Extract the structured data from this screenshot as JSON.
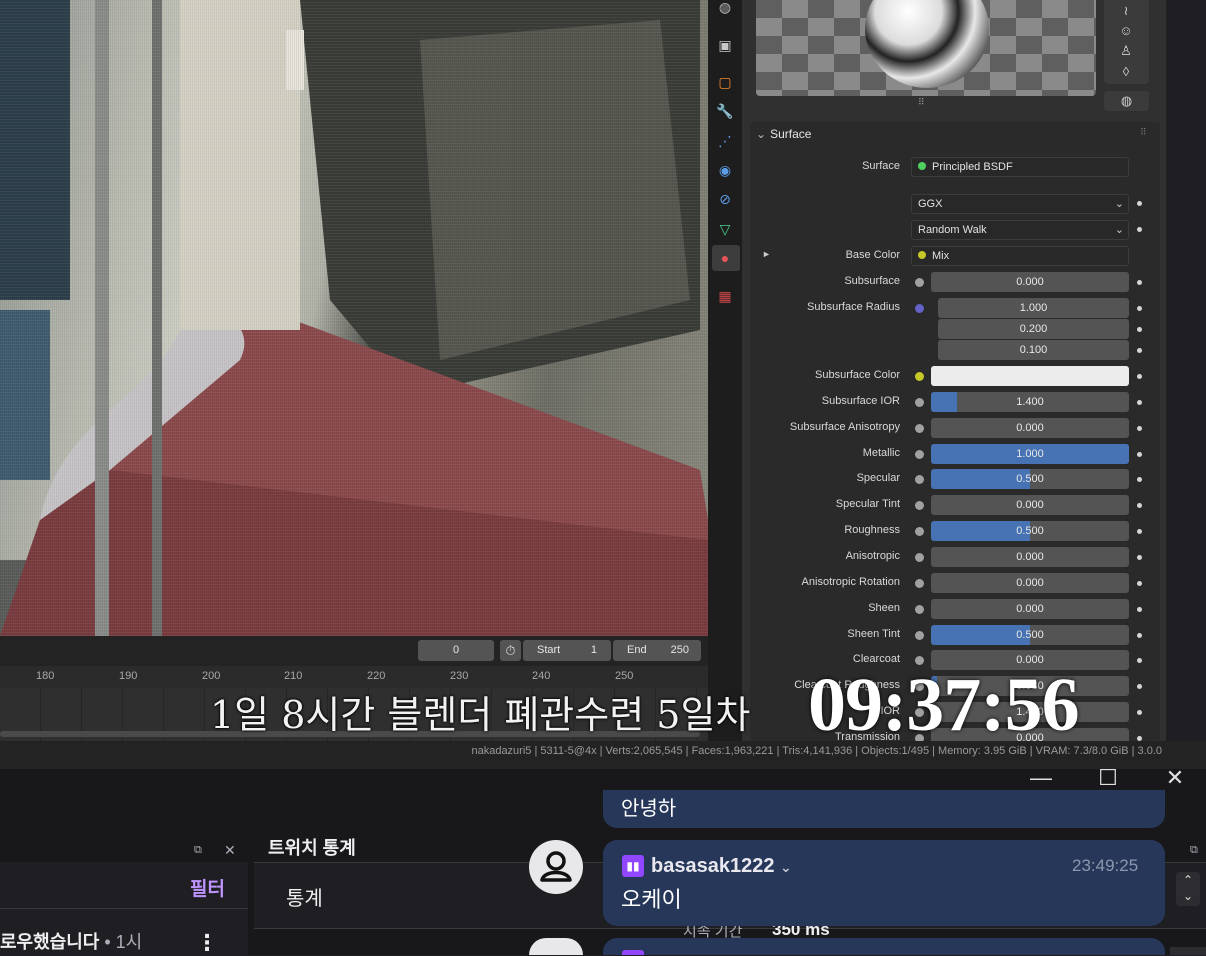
{
  "viewport": {
    "description_icon": "render-viewport"
  },
  "timeline": {
    "current_frame": "0",
    "start_label": "Start",
    "start_value": "1",
    "end_label": "End",
    "end_value": "250",
    "ticks": [
      "180",
      "190",
      "200",
      "210",
      "220",
      "230",
      "240",
      "250"
    ]
  },
  "status_bar": {
    "text": "nakadazuri5 | 5311-5@4x | Verts:2,065,545 | Faces:1,963,221 | Tris:4,141,936 | Objects:1/495 | Memory: 3.95 GiB | VRAM: 7.3/8.0 GiB | 3.0.0"
  },
  "properties": {
    "section_title": "Surface",
    "surface_label": "Surface",
    "surface_value": "Principled BSDF",
    "distribution": "GGX",
    "subsurface_method": "Random Walk",
    "rows": [
      {
        "label": "Base Color",
        "value": "Mix",
        "type": "link",
        "socket_color": "#c7c729"
      },
      {
        "label": "Subsurface",
        "value": "0.000",
        "fill": 0
      },
      {
        "label": "Subsurface Radius",
        "value": "1.000",
        "fill": 0,
        "socket_color": "#6363c7"
      },
      {
        "label": "",
        "value": "0.200",
        "fill": 0
      },
      {
        "label": "",
        "value": "0.100",
        "fill": 0
      },
      {
        "label": "Subsurface Color",
        "value": "",
        "type": "color",
        "socket_color": "#c7c729"
      },
      {
        "label": "Subsurface IOR",
        "value": "1.400",
        "fill": 0.13
      },
      {
        "label": "Subsurface Anisotropy",
        "value": "0.000",
        "fill": 0
      },
      {
        "label": "Metallic",
        "value": "1.000",
        "fill": 1
      },
      {
        "label": "Specular",
        "value": "0.500",
        "fill": 0.5
      },
      {
        "label": "Specular Tint",
        "value": "0.000",
        "fill": 0
      },
      {
        "label": "Roughness",
        "value": "0.500",
        "fill": 0.5
      },
      {
        "label": "Anisotropic",
        "value": "0.000",
        "fill": 0
      },
      {
        "label": "Anisotropic Rotation",
        "value": "0.000",
        "fill": 0
      },
      {
        "label": "Sheen",
        "value": "0.000",
        "fill": 0
      },
      {
        "label": "Sheen Tint",
        "value": "0.500",
        "fill": 0.5
      },
      {
        "label": "Clearcoat",
        "value": "0.000",
        "fill": 0
      },
      {
        "label": "Clearcoat Roughness",
        "value": "0.030",
        "fill": 0.03
      },
      {
        "label": "IOR",
        "value": "1.450",
        "fill": 0
      },
      {
        "label": "Transmission",
        "value": "0.000",
        "fill": 0
      }
    ]
  },
  "overlay": {
    "title": "1일 8시간 블렌더 폐관수련 5일차",
    "clock": "09:37:56"
  },
  "twitch": {
    "filter_label": "필터",
    "follow_text": "로우했습니다",
    "follow_time": " • 1시",
    "stats_tab": "트위치 통계",
    "stats_label": "통계",
    "stat_key": "지속 기간",
    "stat_value": "350 ms",
    "prev_message": "안녕하",
    "chat_user": "basasak1222",
    "chat_time": "23:49:25",
    "chat_message": "오케이"
  },
  "colors": {
    "accent": "#4772b3",
    "twitch_purple": "#bf94ff",
    "chat_bubble": "#26375a"
  }
}
